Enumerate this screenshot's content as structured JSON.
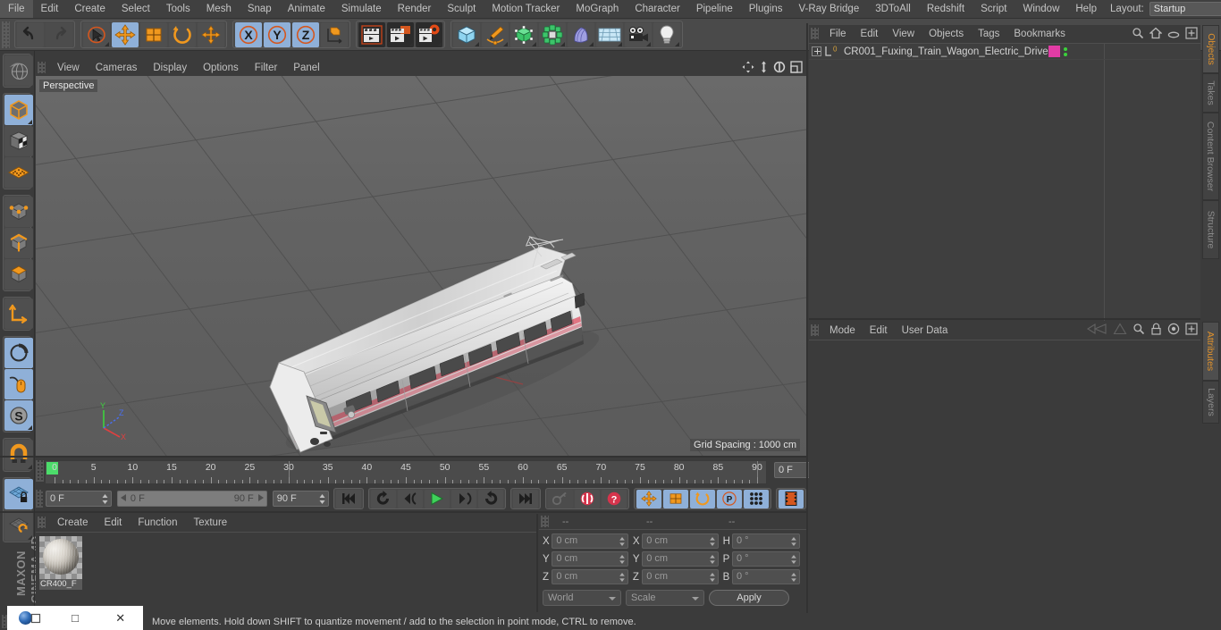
{
  "app": {
    "title": "MAXON CINEMA 4D",
    "brand_line1": "MAXON",
    "brand_line2": "CINEMA 4D"
  },
  "menubar": {
    "items": [
      "File",
      "Edit",
      "Create",
      "Select",
      "Tools",
      "Mesh",
      "Snap",
      "Animate",
      "Simulate",
      "Render",
      "Sculpt",
      "Motion Tracker",
      "MoGraph",
      "Character",
      "Pipeline",
      "Plugins",
      "V-Ray Bridge",
      "3DToAll",
      "Redshift",
      "Script",
      "Window",
      "Help"
    ],
    "layout_label": "Layout:",
    "layout_value": "Startup",
    "search_icon": "search-icon"
  },
  "toolbar": {
    "groups": [
      {
        "name": "undo-redo",
        "buttons": [
          {
            "name": "undo-button",
            "icon": "undo-arrow-icon",
            "selected": false
          },
          {
            "name": "redo-button",
            "icon": "redo-arrow-icon",
            "selected": false,
            "disabled": true
          }
        ]
      },
      {
        "name": "transform-tools",
        "buttons": [
          {
            "name": "live-selection-tool",
            "icon": "cursor-circle-icon",
            "selected": false
          },
          {
            "name": "move-tool",
            "icon": "move-arrows-icon",
            "selected": true
          },
          {
            "name": "scale-tool",
            "icon": "scale-box-icon",
            "selected": false
          },
          {
            "name": "rotate-tool",
            "icon": "rotate-ring-icon",
            "selected": false
          },
          {
            "name": "dynamic-place-tool",
            "icon": "move-plus-icon",
            "selected": false
          }
        ]
      },
      {
        "name": "axis-locks",
        "buttons": [
          {
            "name": "lock-x-axis",
            "icon": "x-axis-icon",
            "selected": true
          },
          {
            "name": "lock-y-axis",
            "icon": "y-axis-icon",
            "selected": true
          },
          {
            "name": "lock-z-axis",
            "icon": "z-axis-icon",
            "selected": true
          },
          {
            "name": "world-object-coordinates",
            "icon": "world-axis-icon",
            "selected": false
          }
        ]
      },
      {
        "name": "render-tools",
        "buttons": [
          {
            "name": "render-view-button",
            "icon": "clapperboard-icon",
            "selected": false
          },
          {
            "name": "render-to-picture-viewer-button",
            "icon": "clapperboard-picture-icon",
            "selected": false
          },
          {
            "name": "render-settings-button",
            "icon": "clapperboard-gear-icon",
            "selected": false
          }
        ]
      },
      {
        "name": "object-creation",
        "buttons": [
          {
            "name": "add-cube-object",
            "icon": "cube-icon",
            "selected": false
          },
          {
            "name": "add-spline-object",
            "icon": "pen-spline-icon",
            "selected": false
          },
          {
            "name": "add-generator-object",
            "icon": "green-cube-icon",
            "selected": false
          },
          {
            "name": "add-mograph-object",
            "icon": "cloner-icon",
            "selected": false
          },
          {
            "name": "add-deformer-object",
            "icon": "bend-deformer-icon",
            "selected": false
          },
          {
            "name": "add-scene-object",
            "icon": "floor-grid-icon",
            "selected": false
          },
          {
            "name": "add-camera-object",
            "icon": "camera-icon",
            "selected": false
          },
          {
            "name": "add-light-object",
            "icon": "lightbulb-icon",
            "selected": false
          }
        ]
      }
    ]
  },
  "left_palette": {
    "groups": [
      {
        "name": "undo-view-group",
        "buttons": [
          {
            "name": "undo-view-button",
            "icon": "globe-sphere-icon",
            "selected": false
          }
        ]
      },
      {
        "name": "editable-group",
        "buttons": [
          {
            "name": "make-editable-button",
            "icon": "cube-solid-icon",
            "selected": true
          },
          {
            "name": "model-mode-button",
            "icon": "cube-checker-icon",
            "selected": false
          },
          {
            "name": "texture-mode-button",
            "icon": "texture-grid-icon",
            "selected": false
          }
        ]
      },
      {
        "name": "component-group",
        "buttons": [
          {
            "name": "points-mode-button",
            "icon": "points-cube-icon",
            "selected": false
          },
          {
            "name": "edges-mode-button",
            "icon": "edges-cube-icon",
            "selected": false
          },
          {
            "name": "polygons-mode-button",
            "icon": "polygons-cube-icon",
            "selected": false
          }
        ]
      },
      {
        "name": "axis-group",
        "buttons": [
          {
            "name": "enable-axis-button",
            "icon": "axis-corner-icon",
            "selected": false
          }
        ]
      },
      {
        "name": "viewport-mode-group",
        "buttons": [
          {
            "name": "viewport-solo-button",
            "icon": "viewport-circle-icon",
            "selected": true
          },
          {
            "name": "enable-snap-button",
            "icon": "mouse-snap-icon",
            "selected": true
          },
          {
            "name": "workplane-button",
            "icon": "s-compass-icon",
            "selected": true
          }
        ]
      },
      {
        "name": "magnet-group",
        "buttons": [
          {
            "name": "magnet-tool-button",
            "icon": "magnet-icon",
            "selected": false
          }
        ]
      },
      {
        "name": "workplane-group",
        "buttons": [
          {
            "name": "lock-workplane-button",
            "icon": "grid-lock-icon",
            "selected": true
          },
          {
            "name": "planar-workplane-button",
            "icon": "grid-rotate-icon",
            "selected": false
          }
        ]
      }
    ]
  },
  "viewport": {
    "menu": [
      "View",
      "Cameras",
      "Display",
      "Options",
      "Filter",
      "Panel"
    ],
    "label": "Perspective",
    "grid_spacing": "Grid Spacing : 1000 cm",
    "axis_gizmo": {
      "x": "X",
      "y": "Y",
      "z": "Z"
    },
    "corner_icons": [
      "pan-view-icon",
      "zoom-view-icon",
      "rotate-view-icon",
      "maximize-view-icon"
    ],
    "model_description": "CR400 Fuxing high-speed train wagon, white body with pink stripe, viewed in perspective on a grey grid floor"
  },
  "timeline": {
    "ruler_start": 0,
    "ruler_end": 90,
    "major_ticks": [
      0,
      5,
      10,
      15,
      20,
      25,
      30,
      35,
      40,
      45,
      50,
      55,
      60,
      65,
      70,
      75,
      80,
      85,
      90
    ],
    "current_frame_display": "0 F",
    "playhead_frame": 0,
    "frame_field_right": "0 F"
  },
  "transport": {
    "current_frame": "0 F",
    "range_start": "0 F",
    "range_end": "90 F",
    "max_frame": "90 F",
    "buttons": [
      {
        "name": "go-to-start-button",
        "icon": "skip-start-icon",
        "selected": false
      },
      {
        "name": "play-backwards-loop-button",
        "icon": "loop-backwards-icon",
        "selected": false
      },
      {
        "name": "step-back-button",
        "icon": "step-back-icon",
        "selected": false
      },
      {
        "name": "play-button",
        "icon": "play-icon",
        "selected": false
      },
      {
        "name": "step-forward-button",
        "icon": "step-forward-icon",
        "selected": false
      },
      {
        "name": "play-forward-loop-button",
        "icon": "loop-forward-icon",
        "selected": false
      },
      {
        "name": "go-to-end-button",
        "icon": "skip-end-icon",
        "selected": false
      },
      {
        "name": "record-active-objects-button",
        "icon": "key-icon",
        "selected": false,
        "disabled": true
      },
      {
        "name": "autokeying-button",
        "icon": "record-circle-icon",
        "selected": false
      },
      {
        "name": "keyframe-selection-button",
        "icon": "question-circle-icon",
        "selected": false
      },
      {
        "name": "record-position-button",
        "icon": "move-arrows-icon",
        "selected": true
      },
      {
        "name": "record-scale-button",
        "icon": "scale-box-icon",
        "selected": true
      },
      {
        "name": "record-rotation-button",
        "icon": "rotate-ring-icon",
        "selected": true
      },
      {
        "name": "record-pla-button",
        "icon": "p-circle-icon",
        "selected": true
      },
      {
        "name": "record-parameter-button",
        "icon": "dots-grid-icon",
        "selected": true
      },
      {
        "name": "timeline-view-button",
        "icon": "filmstrip-icon",
        "selected": true
      }
    ]
  },
  "material_manager": {
    "menu": [
      "Create",
      "Edit",
      "Function",
      "Texture"
    ],
    "materials": [
      {
        "name": "CR400_F",
        "swatch": "sphere-preview"
      }
    ]
  },
  "coordinates": {
    "header_dashes": [
      "--",
      "--",
      "--"
    ],
    "rows": [
      {
        "pos_label": "X",
        "pos_value": "0 cm",
        "size_label": "X",
        "size_value": "0 cm",
        "rot_label": "H",
        "rot_value": "0 °"
      },
      {
        "pos_label": "Y",
        "pos_value": "0 cm",
        "size_label": "Y",
        "size_value": "0 cm",
        "rot_label": "P",
        "rot_value": "0 °"
      },
      {
        "pos_label": "Z",
        "pos_value": "0 cm",
        "size_label": "Z",
        "size_value": "0 cm",
        "rot_label": "B",
        "rot_value": "0 °"
      }
    ],
    "system_dropdown": "World",
    "mode_dropdown": "Scale",
    "apply_button": "Apply"
  },
  "object_manager": {
    "menu": [
      "File",
      "Edit",
      "View",
      "Objects",
      "Tags",
      "Bookmarks"
    ],
    "icons": [
      "search-icon",
      "home-icon",
      "ellipse-icon",
      "plus-box-icon"
    ],
    "objects": [
      {
        "name": "CR001_Fuxing_Train_Wagon_Electric_Drive",
        "layer_badge": "0",
        "material_color": "#e23ca5",
        "has_dots": true
      }
    ]
  },
  "attribute_manager": {
    "menu": [
      "Mode",
      "Edit",
      "User Data"
    ],
    "icons": [
      "arrow-left-icon",
      "arrow-up-icon",
      "search-icon",
      "lock-icon",
      "target-icon",
      "plus-box-icon"
    ]
  },
  "right_tabs": {
    "top_group": [
      {
        "label": "Objects",
        "active": true
      },
      {
        "label": "Takes",
        "active": false
      },
      {
        "label": "Content Browser",
        "active": false
      },
      {
        "label": "Structure",
        "active": false
      }
    ],
    "bottom_group": [
      {
        "label": "Attributes",
        "active": true
      },
      {
        "label": "Layers",
        "active": false
      }
    ]
  },
  "statusbar": {
    "message": "Move elements. Hold down SHIFT to quantize movement / add to the selection in point mode, CTRL to remove."
  },
  "window_overlay": {
    "logo": "cinema4d-logo-icon",
    "restore": "□",
    "close": "✕"
  },
  "colors": {
    "accent_orange": "#e0922c",
    "selected_blue": "#8fb0d8",
    "tool_orange": "#f0981e",
    "playhead_green": "#4cdc6a",
    "material_pink": "#e23ca5",
    "panel_bg": "#3b3b3b",
    "toolbar_bg": "#4a4a4a"
  }
}
